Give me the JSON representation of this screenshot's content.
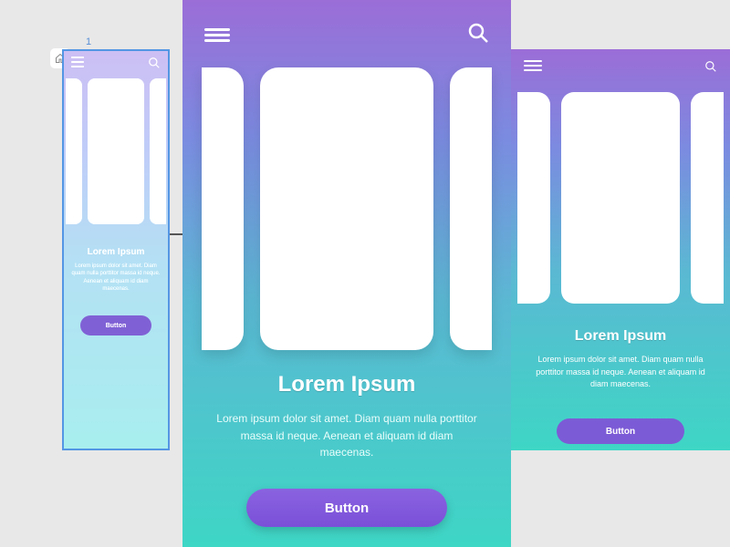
{
  "canvas": {
    "page_label": "1"
  },
  "screens": {
    "left": {
      "heading": "Lorem Ipsum",
      "body": "Lorem ipsum dolor sit amet. Diam quam nulla porttitor massa id neque. Aenean et aliquam id diam maecenas.",
      "button_label": "Button"
    },
    "center": {
      "heading": "Lorem Ipsum",
      "body": "Lorem ipsum dolor sit amet.  Diam quam nulla porttitor massa id neque. Aenean et aliquam id diam maecenas.",
      "button_label": "Button"
    },
    "right": {
      "heading": "Lorem Ipsum",
      "body": "Lorem ipsum dolor sit amet.  Diam quam nulla porttitor massa id neque. Aenean et aliquam id diam maecenas.",
      "button_label": "Button"
    }
  },
  "icons": {
    "menu": "hamburger",
    "search": "magnifier",
    "home": "home",
    "flow_next": "chevron-right"
  },
  "colors": {
    "gradient_top": "#9b6dd7",
    "gradient_bottom": "#3ed6c5",
    "button": "#7c5bd6",
    "selection": "#4a90e2"
  }
}
